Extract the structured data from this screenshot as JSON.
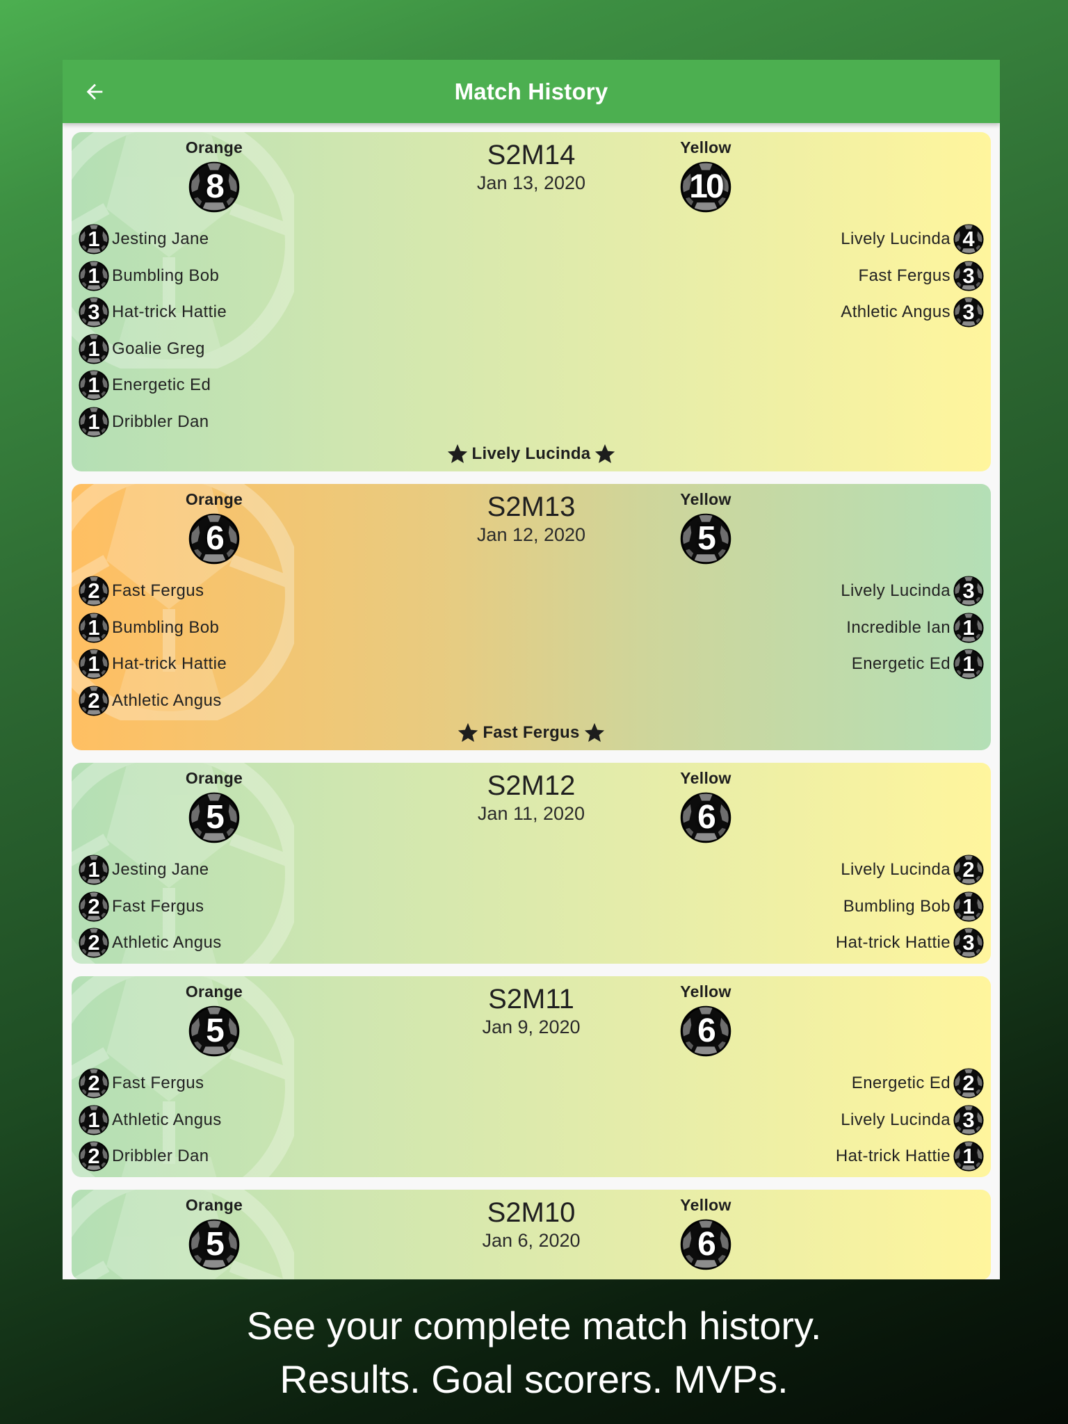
{
  "appbar": {
    "title": "Match History",
    "back_icon": "arrow-left-icon",
    "color": "#4caf50"
  },
  "matches": [
    {
      "id": "S2M14",
      "date": "Jan 13, 2020",
      "winner": "yellow",
      "left": {
        "team": "Orange",
        "score": "8",
        "scorers": [
          {
            "name": "Jesting Jane",
            "goals": "1"
          },
          {
            "name": "Bumbling Bob",
            "goals": "1"
          },
          {
            "name": "Hat-trick Hattie",
            "goals": "3"
          },
          {
            "name": "Goalie Greg",
            "goals": "1"
          },
          {
            "name": "Energetic Ed",
            "goals": "1"
          },
          {
            "name": "Dribbler Dan",
            "goals": "1"
          }
        ]
      },
      "right": {
        "team": "Yellow",
        "score": "10",
        "scorers": [
          {
            "name": "Lively Lucinda",
            "goals": "4"
          },
          {
            "name": "Fast Fergus",
            "goals": "3"
          },
          {
            "name": "Athletic Angus",
            "goals": "3"
          }
        ]
      },
      "mvp": "Lively Lucinda"
    },
    {
      "id": "S2M13",
      "date": "Jan 12, 2020",
      "winner": "orange",
      "left": {
        "team": "Orange",
        "score": "6",
        "scorers": [
          {
            "name": "Fast Fergus",
            "goals": "2"
          },
          {
            "name": "Bumbling Bob",
            "goals": "1"
          },
          {
            "name": "Hat-trick Hattie",
            "goals": "1"
          },
          {
            "name": "Athletic Angus",
            "goals": "2"
          }
        ]
      },
      "right": {
        "team": "Yellow",
        "score": "5",
        "scorers": [
          {
            "name": "Lively Lucinda",
            "goals": "3"
          },
          {
            "name": "Incredible Ian",
            "goals": "1"
          },
          {
            "name": "Energetic Ed",
            "goals": "1"
          }
        ]
      },
      "mvp": "Fast Fergus"
    },
    {
      "id": "S2M12",
      "date": "Jan 11, 2020",
      "winner": "yellow",
      "left": {
        "team": "Orange",
        "score": "5",
        "scorers": [
          {
            "name": "Jesting Jane",
            "goals": "1"
          },
          {
            "name": "Fast Fergus",
            "goals": "2"
          },
          {
            "name": "Athletic Angus",
            "goals": "2"
          }
        ]
      },
      "right": {
        "team": "Yellow",
        "score": "6",
        "scorers": [
          {
            "name": "Lively Lucinda",
            "goals": "2"
          },
          {
            "name": "Bumbling Bob",
            "goals": "1"
          },
          {
            "name": "Hat-trick Hattie",
            "goals": "3"
          }
        ]
      },
      "mvp": null
    },
    {
      "id": "S2M11",
      "date": "Jan 9, 2020",
      "winner": "yellow",
      "left": {
        "team": "Orange",
        "score": "5",
        "scorers": [
          {
            "name": "Fast Fergus",
            "goals": "2"
          },
          {
            "name": "Athletic Angus",
            "goals": "1"
          },
          {
            "name": "Dribbler Dan",
            "goals": "2"
          }
        ]
      },
      "right": {
        "team": "Yellow",
        "score": "6",
        "scorers": [
          {
            "name": "Energetic Ed",
            "goals": "2"
          },
          {
            "name": "Lively Lucinda",
            "goals": "3"
          },
          {
            "name": "Hat-trick Hattie",
            "goals": "1"
          }
        ]
      },
      "mvp": null
    },
    {
      "id": "S2M10",
      "date": "Jan 6, 2020",
      "winner": "yellow",
      "left": {
        "team": "Orange",
        "score": "5",
        "scorers": []
      },
      "right": {
        "team": "Yellow",
        "score": "6",
        "scorers": []
      },
      "mvp": null
    }
  ],
  "caption": {
    "line1": "See your complete match history.",
    "line2": "Results. Goal scorers. MVPs."
  },
  "colors": {
    "orange_team": "#ffbf62",
    "yellow_team": "#fff59d",
    "green_mid": "#b4dfb5"
  }
}
